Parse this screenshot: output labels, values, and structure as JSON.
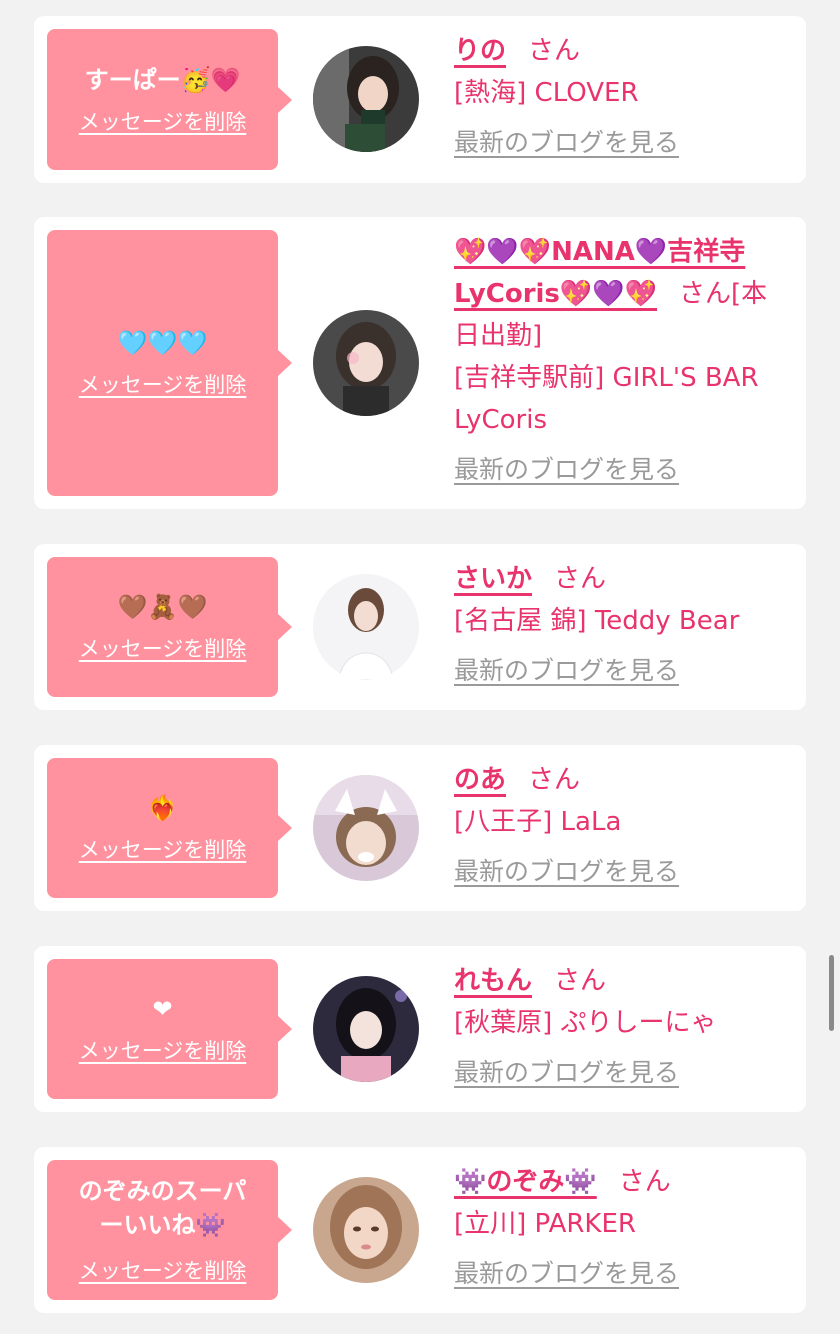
{
  "messages": [
    {
      "message": "すーぱー🥳💗",
      "delete_label": "メッセージを削除",
      "name": "りの",
      "suffix": "さん",
      "shop": "[熱海] CLOVER",
      "blog_label": "最新のブログを見る"
    },
    {
      "message": "🩵🩵🩵",
      "delete_label": "メッセージを削除",
      "name": "💖💜💖NANA💜吉祥寺LyCoris💖💜💖",
      "suffix": "さん[本日出勤]",
      "shop": "[吉祥寺駅前] GIRL'S BAR LyCoris",
      "blog_label": "最新のブログを見る"
    },
    {
      "message": "🤎🧸🤎",
      "delete_label": "メッセージを削除",
      "name": "さいか",
      "suffix": "さん",
      "shop": "[名古屋 錦] Teddy Bear",
      "blog_label": "最新のブログを見る"
    },
    {
      "message": "❤️‍🔥",
      "delete_label": "メッセージを削除",
      "name": "のあ",
      "suffix": "さん",
      "shop": "[八王子] LaLa",
      "blog_label": "最新のブログを見る"
    },
    {
      "message": "❤",
      "delete_label": "メッセージを削除",
      "name": "れもん",
      "suffix": "さん",
      "shop": "[秋葉原] ぷりしーにゃ",
      "blog_label": "最新のブログを見る"
    },
    {
      "message": "のぞみのスーパーいいね👾",
      "delete_label": "メッセージを削除",
      "name": "👾のぞみ👾",
      "suffix": "さん",
      "shop": "[立川] PARKER",
      "blog_label": "最新のブログを見る"
    }
  ],
  "colors": {
    "accent": "#e8336d",
    "bubble": "#ff929e",
    "background": "#f2f2f2"
  }
}
